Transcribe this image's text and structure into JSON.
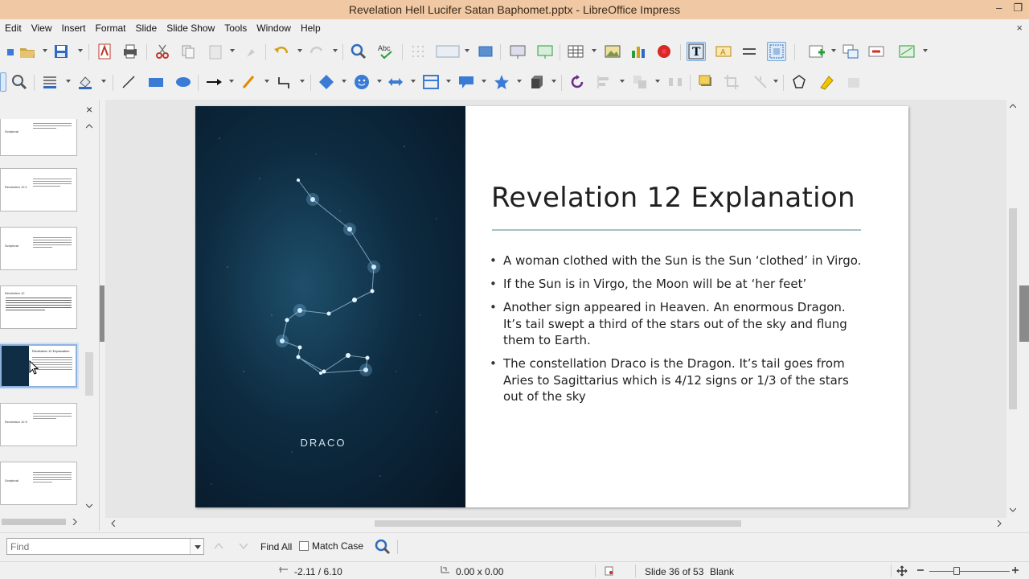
{
  "window": {
    "title": "Revelation Hell Lucifer Satan Baphomet.pptx - LibreOffice Impress",
    "minimize_glyph": "–",
    "restore_glyph": "❐"
  },
  "menu": {
    "items": [
      "Edit",
      "View",
      "Insert",
      "Format",
      "Slide",
      "Slide Show",
      "Tools",
      "Window",
      "Help"
    ],
    "close_glyph": "×"
  },
  "slide_pane": {
    "close_glyph": "×",
    "thumbnails": [
      {
        "title": "Scriptural"
      },
      {
        "title": "Revelation 12:1"
      },
      {
        "title": "Scriptural"
      },
      {
        "title": "Revelation 12"
      },
      {
        "title": "Revelation 12 Explanation"
      },
      {
        "title": "Revelation 12:3"
      },
      {
        "title": "Scriptural"
      }
    ]
  },
  "slide": {
    "image_caption": "DRACO",
    "title": "Revelation 12 Explanation",
    "bullets": [
      "A woman clothed with the Sun is the Sun ‘clothed’ in Virgo.",
      "If the Sun is in Virgo, the Moon will be at ‘her feet’",
      "Another sign appeared in Heaven. An enormous Dragon. It’s tail swept a third of the stars out of the sky and flung them to Earth.",
      "The constellation Draco is the Dragon. It’s tail goes from Aries to Sagittarius which is 4/12 signs or 1/3 of the stars out of the sky"
    ]
  },
  "find_bar": {
    "placeholder": "Find",
    "find_all_label": "Find All",
    "match_case_label": "Match Case"
  },
  "status_bar": {
    "position": "-2.11 / 6.10",
    "size": "0.00 x 0.00",
    "slide_counter": "Slide 36 of 53",
    "layout": "Blank"
  },
  "colors": {
    "title_bar": "#f0c8a4",
    "slide_title_rule": "#a5c0c4",
    "selected_thumb_border": "#8fb2dc"
  }
}
